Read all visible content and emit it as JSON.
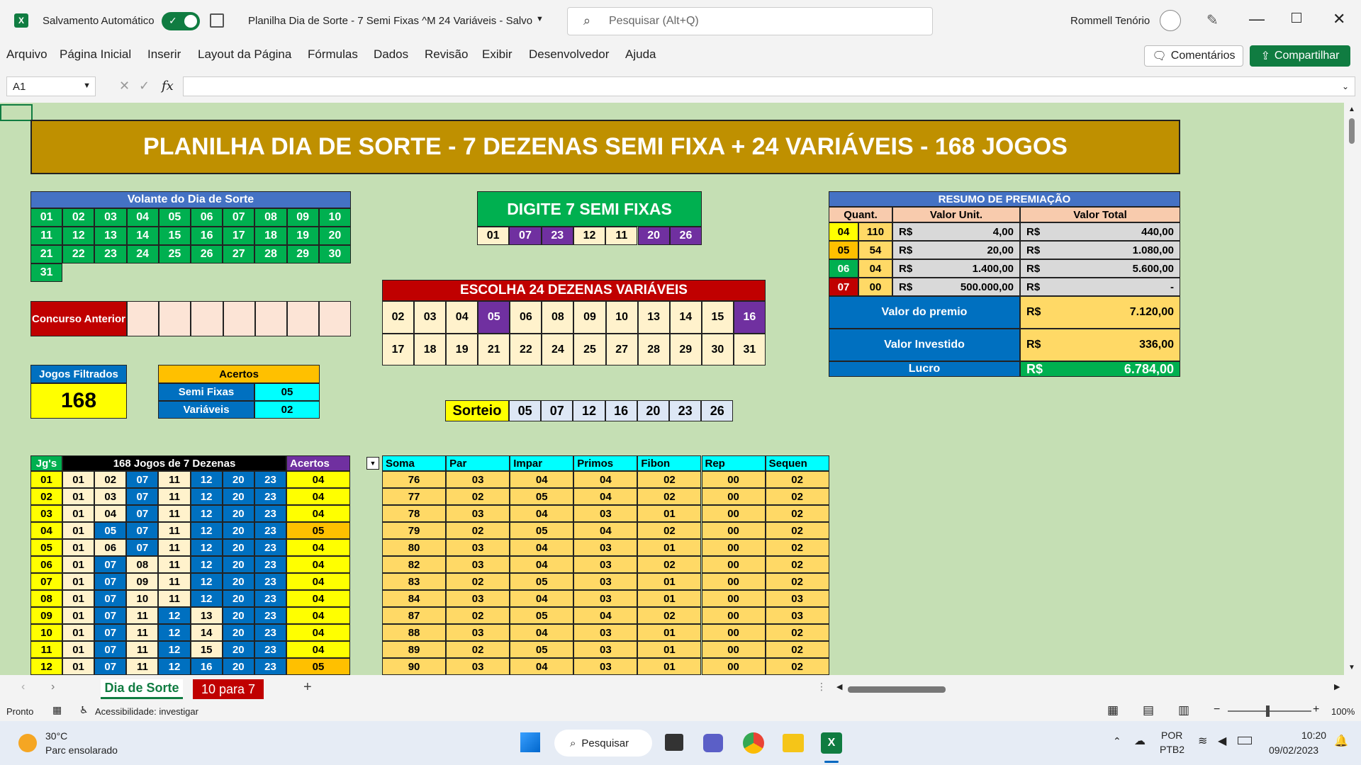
{
  "window": {
    "autosave_label": "Salvamento Automático",
    "doc_title": "Planilha Dia de Sorte - 7 Semi Fixas ^M 24 Variáveis - Salvo",
    "search_placeholder": "Pesquisar (Alt+Q)",
    "user_name": "Rommell Tenório"
  },
  "ribbon": {
    "tabs": [
      "Arquivo",
      "Página Inicial",
      "Inserir",
      "Layout da Página",
      "Fórmulas",
      "Dados",
      "Revisão",
      "Exibir",
      "Desenvolvedor",
      "Ajuda"
    ],
    "comments_label": "Comentários",
    "share_label": "Compartilhar"
  },
  "formula_bar": {
    "name_box": "A1",
    "fx": "fx",
    "formula": ""
  },
  "sheet": {
    "title": "PLANILHA DIA DE SORTE - 7 DEZENAS SEMI FIXA + 24 VARIÁVEIS - 168 JOGOS",
    "volante": {
      "title": "Volante do Dia de Sorte",
      "rows": [
        [
          "01",
          "02",
          "03",
          "04",
          "05",
          "06",
          "07",
          "08",
          "09",
          "10"
        ],
        [
          "11",
          "12",
          "13",
          "14",
          "15",
          "16",
          "17",
          "18",
          "19",
          "20"
        ],
        [
          "21",
          "22",
          "23",
          "24",
          "25",
          "26",
          "27",
          "28",
          "29",
          "30"
        ],
        [
          "31"
        ]
      ]
    },
    "semi_fixas": {
      "title": "DIGITE 7 SEMI FIXAS",
      "values": [
        "01",
        "07",
        "23",
        "12",
        "11",
        "20",
        "26"
      ]
    },
    "variaveis": {
      "title": "ESCOLHA 24 DEZENAS VARIÁVEIS",
      "row1": [
        "02",
        "03",
        "04",
        "05",
        "06",
        "08",
        "09",
        "10",
        "13",
        "14",
        "15",
        "16"
      ],
      "row2": [
        "17",
        "18",
        "19",
        "21",
        "22",
        "24",
        "25",
        "27",
        "28",
        "29",
        "30",
        "31"
      ]
    },
    "premiacao": {
      "title": "RESUMO DE PREMIAÇÃO",
      "headers": [
        "Quant.",
        "Valor Unit.",
        "Valor Total"
      ],
      "rows": [
        {
          "hits": "04",
          "qty": "110",
          "cur1": "R$",
          "unit": "4,00",
          "cur2": "R$",
          "total": "440,00"
        },
        {
          "hits": "05",
          "qty": "54",
          "cur1": "R$",
          "unit": "20,00",
          "cur2": "R$",
          "total": "1.080,00"
        },
        {
          "hits": "06",
          "qty": "04",
          "cur1": "R$",
          "unit": "1.400,00",
          "cur2": "R$",
          "total": "5.600,00"
        },
        {
          "hits": "07",
          "qty": "00",
          "cur1": "R$",
          "unit": "500.000,00",
          "cur2": "R$",
          "total": "-"
        }
      ],
      "premio_label": "Valor do premio",
      "premio_value": "7.120,00",
      "investido_label": "Valor Investido",
      "investido_value": "336,00",
      "lucro_label": "Lucro",
      "lucro_value": "6.784,00",
      "currency": "R$"
    },
    "concurso": {
      "label": "Concurso Anterior"
    },
    "jogos_filtrados": {
      "label": "Jogos Filtrados",
      "value": "168"
    },
    "acertos": {
      "title": "Acertos",
      "semi_label": "Semi Fixas",
      "semi_value": "05",
      "var_label": "Variáveis",
      "var_value": "02"
    },
    "sorteio": {
      "label": "Sorteio",
      "values": [
        "05",
        "07",
        "12",
        "16",
        "20",
        "23",
        "26"
      ]
    },
    "games": {
      "headers": {
        "jg": "Jg's",
        "jogos": "168 Jogos de 7 Dezenas",
        "acertos": "Acertos"
      },
      "stat_headers": [
        "Soma",
        "Par",
        "Impar",
        "Primos",
        "Fibon",
        "Rep",
        "Sequen"
      ],
      "rows": [
        {
          "n": "01",
          "d": [
            "01",
            "02",
            "07",
            "11",
            "12",
            "20",
            "23"
          ],
          "a": "04",
          "s": [
            "76",
            "03",
            "04",
            "04",
            "02",
            "00",
            "02"
          ]
        },
        {
          "n": "02",
          "d": [
            "01",
            "03",
            "07",
            "11",
            "12",
            "20",
            "23"
          ],
          "a": "04",
          "s": [
            "77",
            "02",
            "05",
            "04",
            "02",
            "00",
            "02"
          ]
        },
        {
          "n": "03",
          "d": [
            "01",
            "04",
            "07",
            "11",
            "12",
            "20",
            "23"
          ],
          "a": "04",
          "s": [
            "78",
            "03",
            "04",
            "03",
            "01",
            "00",
            "02"
          ]
        },
        {
          "n": "04",
          "d": [
            "01",
            "05",
            "07",
            "11",
            "12",
            "20",
            "23"
          ],
          "a": "05",
          "s": [
            "79",
            "02",
            "05",
            "04",
            "02",
            "00",
            "02"
          ]
        },
        {
          "n": "05",
          "d": [
            "01",
            "06",
            "07",
            "11",
            "12",
            "20",
            "23"
          ],
          "a": "04",
          "s": [
            "80",
            "03",
            "04",
            "03",
            "01",
            "00",
            "02"
          ]
        },
        {
          "n": "06",
          "d": [
            "01",
            "07",
            "08",
            "11",
            "12",
            "20",
            "23"
          ],
          "a": "04",
          "s": [
            "82",
            "03",
            "04",
            "03",
            "02",
            "00",
            "02"
          ]
        },
        {
          "n": "07",
          "d": [
            "01",
            "07",
            "09",
            "11",
            "12",
            "20",
            "23"
          ],
          "a": "04",
          "s": [
            "83",
            "02",
            "05",
            "03",
            "01",
            "00",
            "02"
          ]
        },
        {
          "n": "08",
          "d": [
            "01",
            "07",
            "10",
            "11",
            "12",
            "20",
            "23"
          ],
          "a": "04",
          "s": [
            "84",
            "03",
            "04",
            "03",
            "01",
            "00",
            "03"
          ]
        },
        {
          "n": "09",
          "d": [
            "01",
            "07",
            "11",
            "12",
            "13",
            "20",
            "23"
          ],
          "a": "04",
          "s": [
            "87",
            "02",
            "05",
            "04",
            "02",
            "00",
            "03"
          ]
        },
        {
          "n": "10",
          "d": [
            "01",
            "07",
            "11",
            "12",
            "14",
            "20",
            "23"
          ],
          "a": "04",
          "s": [
            "88",
            "03",
            "04",
            "03",
            "01",
            "00",
            "02"
          ]
        },
        {
          "n": "11",
          "d": [
            "01",
            "07",
            "11",
            "12",
            "15",
            "20",
            "23"
          ],
          "a": "04",
          "s": [
            "89",
            "02",
            "05",
            "03",
            "01",
            "00",
            "02"
          ]
        },
        {
          "n": "12",
          "d": [
            "01",
            "07",
            "11",
            "12",
            "16",
            "20",
            "23"
          ],
          "a": "05",
          "s": [
            "90",
            "03",
            "04",
            "03",
            "01",
            "00",
            "02"
          ]
        }
      ]
    }
  },
  "sheet_tabs": [
    "Dia de Sorte",
    "10 para 7"
  ],
  "status": {
    "ready": "Pronto",
    "accessibility": "Acessibilidade: investigar",
    "zoom": "100%"
  },
  "taskbar": {
    "temp": "30°C",
    "weather": "Parc ensolarado",
    "search": "Pesquisar",
    "lang1": "POR",
    "lang2": "PTB2",
    "time": "10:20",
    "date": "09/02/2023"
  },
  "colors": {
    "sheet_bg": "#c5dfb4",
    "title_bg": "#bf9000",
    "excel_green": "#107c41"
  }
}
